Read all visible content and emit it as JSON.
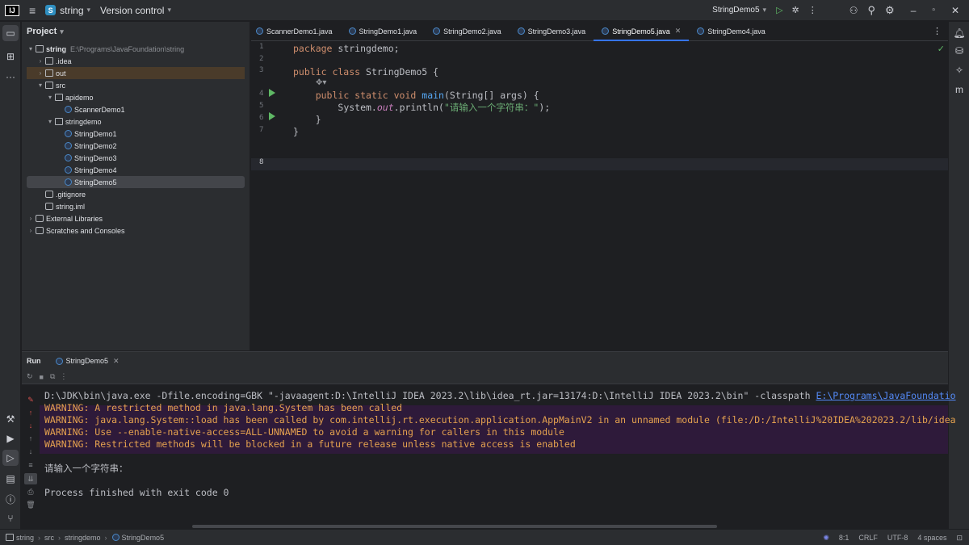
{
  "titlebar": {
    "project_name": "string",
    "project_badge": "S",
    "vcs_label": "Version control",
    "run_config": "StringDemo5"
  },
  "project_panel": {
    "title": "Project",
    "tree": [
      {
        "label": "string",
        "path": "E:\\Programs\\JavaFoundation\\string",
        "arrow": "▾",
        "icon": "folder"
      },
      {
        "label": ".idea",
        "arrow": "›",
        "icon": "folder"
      },
      {
        "label": "out",
        "arrow": "›",
        "icon": "folder"
      },
      {
        "label": "src",
        "arrow": "▾",
        "icon": "folder"
      },
      {
        "label": "apidemo",
        "arrow": "▾",
        "icon": "folder"
      },
      {
        "label": "ScannerDemo1",
        "arrow": "",
        "icon": "class"
      },
      {
        "label": "stringdemo",
        "arrow": "▾",
        "icon": "folder"
      },
      {
        "label": "StringDemo1",
        "arrow": "",
        "icon": "class"
      },
      {
        "label": "StringDemo2",
        "arrow": "",
        "icon": "class"
      },
      {
        "label": "StringDemo3",
        "arrow": "",
        "icon": "class"
      },
      {
        "label": "StringDemo4",
        "arrow": "",
        "icon": "class"
      },
      {
        "label": "StringDemo5",
        "arrow": "",
        "icon": "class"
      },
      {
        "label": ".gitignore",
        "arrow": "",
        "icon": "gitignore-icon"
      },
      {
        "label": "string.iml",
        "arrow": "",
        "icon": "file"
      },
      {
        "label": "External Libraries",
        "arrow": "›",
        "icon": "library"
      },
      {
        "label": "Scratches and Consoles",
        "arrow": "›",
        "icon": "scratch"
      }
    ]
  },
  "editor": {
    "tabs": [
      {
        "label": "ScannerDemo1.java"
      },
      {
        "label": "StringDemo1.java"
      },
      {
        "label": "StringDemo2.java"
      },
      {
        "label": "StringDemo3.java"
      },
      {
        "label": "StringDemo5.java",
        "active": true
      },
      {
        "label": "StringDemo4.java"
      }
    ],
    "line_numbers": [
      "1",
      "2",
      "3",
      "",
      "4",
      "5",
      "6",
      "7",
      "8"
    ],
    "code": {
      "l1_kw": "package",
      "l1_rest": " stringdemo;",
      "l3_kw": "public class",
      "l3_rest": " StringDemo5 {",
      "l4_kw": "public static void",
      "l4_fn": "main",
      "l4_rest": "(String[] args) {",
      "l5_a": "System.",
      "l5_it": "out",
      "l5_b": ".println(",
      "l5_str": "\"请输入一个字符串：\"",
      "l5_c": ");",
      "l6": "    }",
      "l7": "}"
    }
  },
  "run_panel": {
    "tab_label": "Run",
    "config_tab": "StringDemo5",
    "console": {
      "cmd": "D:\\JDK\\bin\\java.exe -Dfile.encoding=GBK \"-javaagent:D:\\IntelliJ IDEA 2023.2\\lib\\idea_rt.jar=13174:D:\\IntelliJ IDEA 2023.2\\bin\" -classpath ",
      "cmd_link": "E:\\Programs\\JavaFoundatio",
      "w1": "WARNING: A restricted method in java.lang.System has been called",
      "w2": "WARNING: java.lang.System::load has been called by com.intellij.rt.execution.application.AppMainV2 in an unnamed module (file:/D:/IntelliJ%20IDEA%202023.2/lib/idea",
      "w3": "WARNING: Use --enable-native-access=ALL-UNNAMED to avoid a warning for callers in this module",
      "w4": "WARNING: Restricted methods will be blocked in a future release unless native access is enabled",
      "prompt": "请输入一个字符串：",
      "exit": "Process finished with exit code 0"
    }
  },
  "statusbar": {
    "crumbs": [
      "string",
      "src",
      "stringdemo",
      "StringDemo5"
    ],
    "position": "8:1",
    "line_sep": "CRLF",
    "encoding": "UTF-8",
    "indent": "4 spaces"
  },
  "colors": {
    "accent": "#3574f0",
    "warning_text": "#e5a24f",
    "warning_bg": "#2e1a3a",
    "run_green": "#5fb865"
  }
}
